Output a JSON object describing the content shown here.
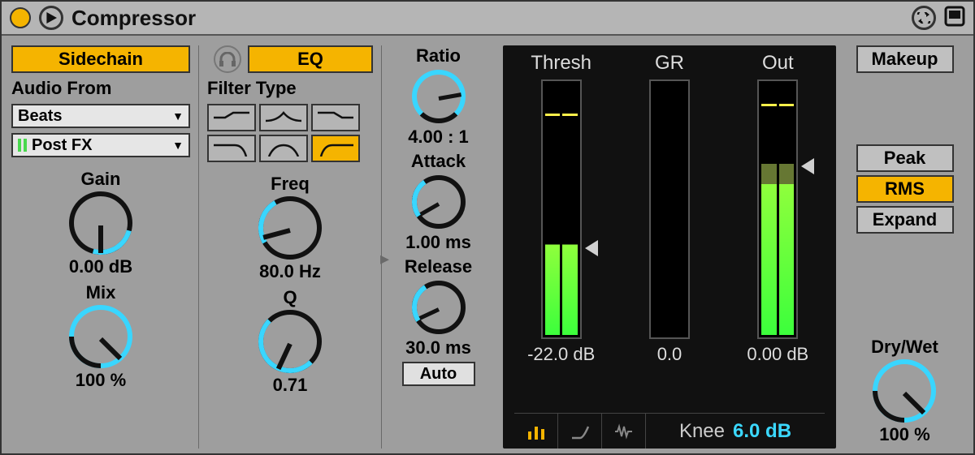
{
  "title": "Compressor",
  "sidechain": {
    "tab_label": "Sidechain"
  },
  "eq": {
    "tab_label": "EQ"
  },
  "audio_from": {
    "label": "Audio From",
    "source": "Beats",
    "tap": "Post FX"
  },
  "gain": {
    "label": "Gain",
    "value": "0.00 dB"
  },
  "mix": {
    "label": "Mix",
    "value": "100 %"
  },
  "filter_type": {
    "label": "Filter Type"
  },
  "freq": {
    "label": "Freq",
    "value": "80.0 Hz"
  },
  "q": {
    "label": "Q",
    "value": "0.71"
  },
  "ratio": {
    "label": "Ratio",
    "value": "4.00 : 1"
  },
  "attack": {
    "label": "Attack",
    "value": "1.00 ms"
  },
  "release": {
    "label": "Release",
    "value": "30.0 ms"
  },
  "auto_label": "Auto",
  "meters": {
    "thresh": {
      "label": "Thresh",
      "value": "-22.0 dB"
    },
    "gr": {
      "label": "GR",
      "value": "0.0"
    },
    "out": {
      "label": "Out",
      "value": "0.00 dB"
    }
  },
  "knee": {
    "label": "Knee",
    "value": "6.0 dB"
  },
  "makeup_label": "Makeup",
  "mode": {
    "peak": "Peak",
    "rms": "RMS",
    "expand": "Expand"
  },
  "drywet": {
    "label": "Dry/Wet",
    "value": "100 %"
  }
}
